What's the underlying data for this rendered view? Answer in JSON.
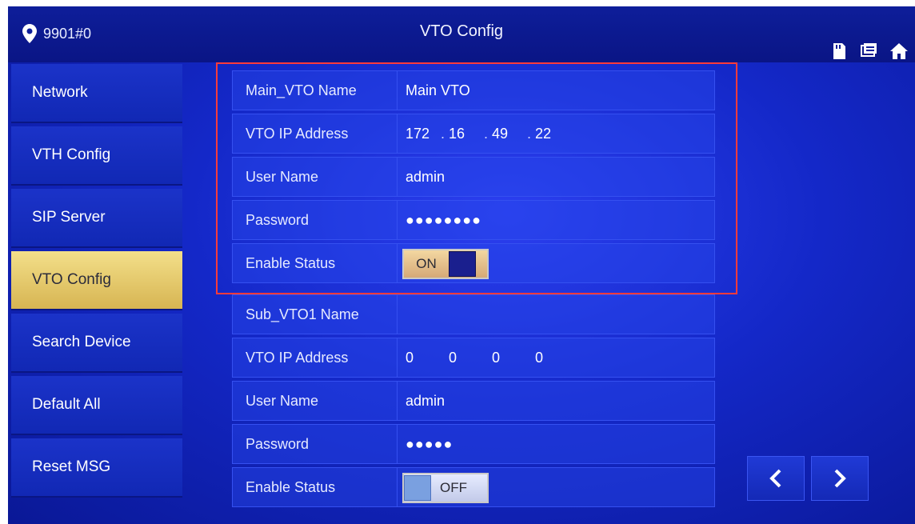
{
  "header": {
    "location": "9901#0",
    "title": "VTO Config",
    "icons": [
      "sd-card-icon",
      "messages-icon",
      "home-icon"
    ]
  },
  "sidebar": {
    "items": [
      {
        "label": "Network",
        "active": false
      },
      {
        "label": "VTH Config",
        "active": false
      },
      {
        "label": "SIP Server",
        "active": false
      },
      {
        "label": "VTO Config",
        "active": true
      },
      {
        "label": "Search Device",
        "active": false
      },
      {
        "label": "Default All",
        "active": false
      },
      {
        "label": "Reset MSG",
        "active": false
      }
    ]
  },
  "main_vto": {
    "name_label": "Main_VTO Name",
    "name_value": "Main VTO",
    "ip_label": "VTO IP Address",
    "ip": [
      "172",
      "16",
      "49",
      "22"
    ],
    "user_label": "User Name",
    "user_value": "admin",
    "password_label": "Password",
    "password_value": "●●●●●●●●",
    "status_label": "Enable Status",
    "status_value": "ON"
  },
  "sub_vto1": {
    "name_label": "Sub_VTO1 Name",
    "name_value": "",
    "ip_label": "VTO IP Address",
    "ip": [
      "0",
      "0",
      "0",
      "0"
    ],
    "user_label": "User Name",
    "user_value": "admin",
    "password_label": "Password",
    "password_value": "●●●●●",
    "status_label": "Enable Status",
    "status_value": "OFF"
  },
  "colors": {
    "background": "#1428c8",
    "active_tab": "#e9cd6e",
    "highlight_border": "#ff3b3b"
  }
}
